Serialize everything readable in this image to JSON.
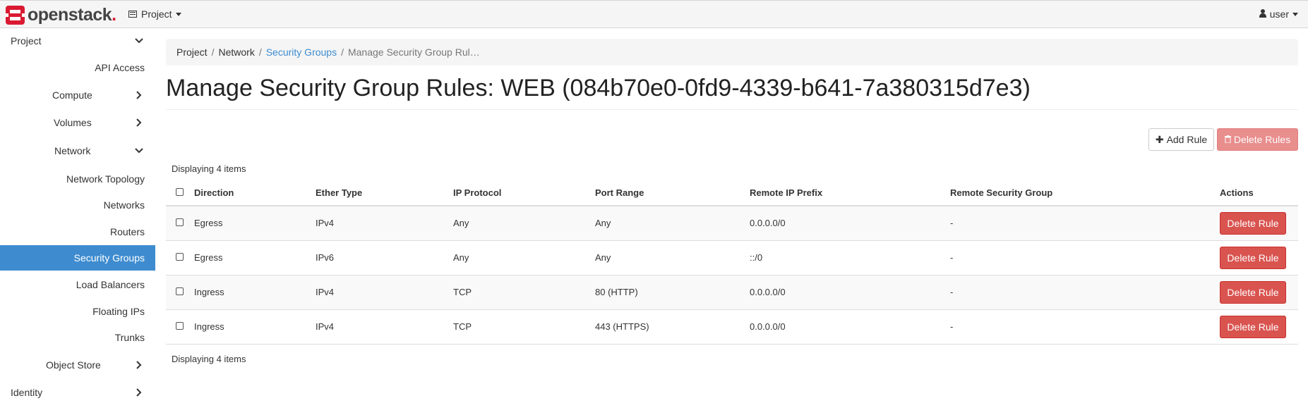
{
  "header": {
    "brand_text": "openstack",
    "brand_dot": ".",
    "project_menu_label": "Project",
    "user_menu_label": "user"
  },
  "sidebar": {
    "items": [
      {
        "label": "Project"
      },
      {
        "label": "API Access"
      },
      {
        "label": "Compute"
      },
      {
        "label": "Volumes"
      },
      {
        "label": "Network"
      },
      {
        "label": "Network Topology"
      },
      {
        "label": "Networks"
      },
      {
        "label": "Routers"
      },
      {
        "label": "Security Groups"
      },
      {
        "label": "Load Balancers"
      },
      {
        "label": "Floating IPs"
      },
      {
        "label": "Trunks"
      },
      {
        "label": "Object Store"
      },
      {
        "label": "Identity"
      }
    ]
  },
  "breadcrumb": {
    "items": [
      "Project",
      "Network",
      "Security Groups",
      "Manage Security Group Rul…"
    ],
    "separator": "/"
  },
  "page": {
    "title": "Manage Security Group Rules: WEB (084b70e0-0fd9-4339-b641-7a380315d7e3)"
  },
  "actions": {
    "add_rule_label": "Add Rule",
    "delete_rules_label": "Delete Rules"
  },
  "table": {
    "count_top": "Displaying 4 items",
    "count_bottom": "Displaying 4 items",
    "columns": [
      "Direction",
      "Ether Type",
      "IP Protocol",
      "Port Range",
      "Remote IP Prefix",
      "Remote Security Group",
      "Actions"
    ],
    "rows": [
      {
        "direction": "Egress",
        "ether_type": "IPv4",
        "ip_protocol": "Any",
        "port_range": "Any",
        "remote_ip_prefix": "0.0.0.0/0",
        "remote_security_group": "-",
        "action_label": "Delete Rule"
      },
      {
        "direction": "Egress",
        "ether_type": "IPv6",
        "ip_protocol": "Any",
        "port_range": "Any",
        "remote_ip_prefix": "::/0",
        "remote_security_group": "-",
        "action_label": "Delete Rule"
      },
      {
        "direction": "Ingress",
        "ether_type": "IPv4",
        "ip_protocol": "TCP",
        "port_range": "80 (HTTP)",
        "remote_ip_prefix": "0.0.0.0/0",
        "remote_security_group": "-",
        "action_label": "Delete Rule"
      },
      {
        "direction": "Ingress",
        "ether_type": "IPv4",
        "ip_protocol": "TCP",
        "port_range": "443 (HTTPS)",
        "remote_ip_prefix": "0.0.0.0/0",
        "remote_security_group": "-",
        "action_label": "Delete Rule"
      }
    ]
  },
  "colors": {
    "brand_red": "#da1a32",
    "active_blue": "#3e8ccf",
    "danger": "#d9534f"
  }
}
